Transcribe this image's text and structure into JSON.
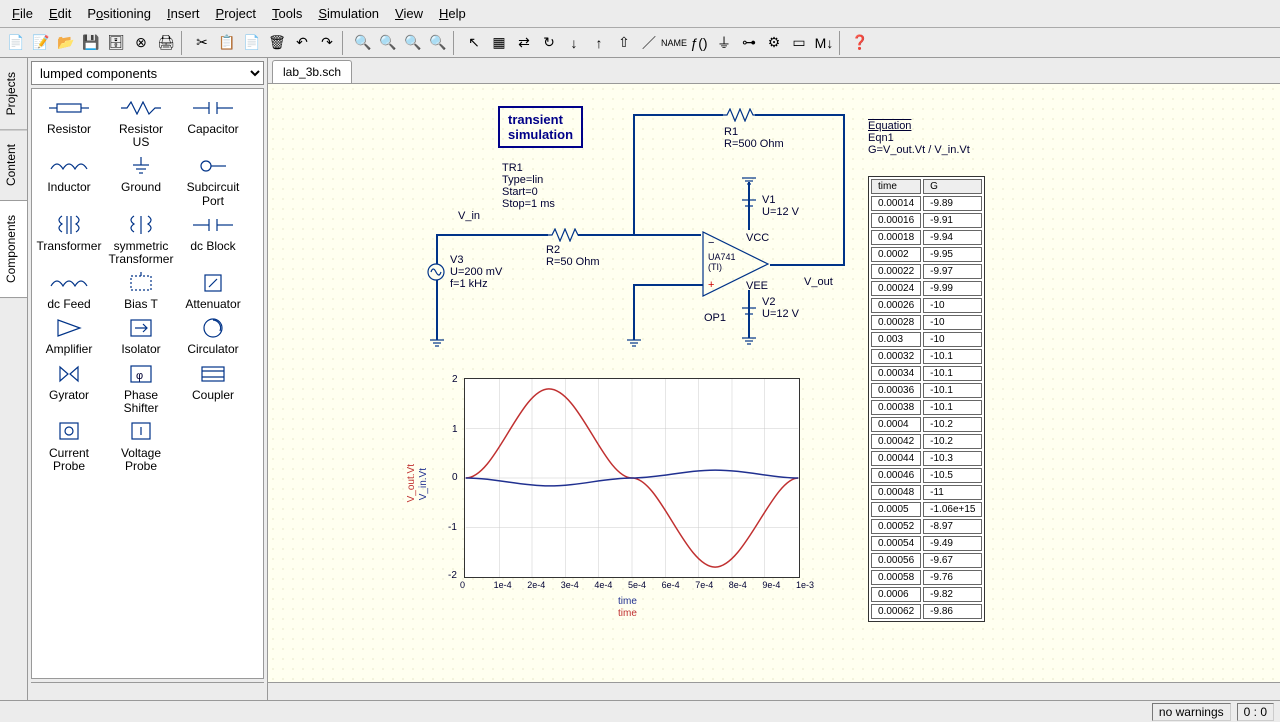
{
  "menu": [
    "File",
    "Edit",
    "Positioning",
    "Insert",
    "Project",
    "Tools",
    "Simulation",
    "View",
    "Help"
  ],
  "sideTabs": [
    "Projects",
    "Content",
    "Components"
  ],
  "combo": "lumped components",
  "components": [
    "Resistor",
    "Resistor US",
    "Capacitor",
    "Inductor",
    "Ground",
    "Subcircuit Port",
    "Transformer",
    "symmetric Transformer",
    "dc Block",
    "dc Feed",
    "Bias T",
    "Attenuator",
    "Amplifier",
    "Isolator",
    "Circulator",
    "Gyrator",
    "Phase Shifter",
    "Coupler",
    "Current Probe",
    "Voltage Probe"
  ],
  "fileTab": "lab_3b.sch",
  "schematic": {
    "simBox": {
      "l1": "transient",
      "l2": "simulation"
    },
    "simParams": [
      "TR1",
      "Type=lin",
      "Start=0",
      "Stop=1 ms"
    ],
    "vin_label": "V_in",
    "v3": [
      "V3",
      "U=200 mV",
      "f=1 kHz"
    ],
    "r1": [
      "R1",
      "R=500 Ohm"
    ],
    "r2": [
      "R2",
      "R=50 Ohm"
    ],
    "v1": [
      "V1",
      "U=12 V"
    ],
    "v2": [
      "V2",
      "U=12 V"
    ],
    "vcc": "VCC",
    "vee": "VEE",
    "ua": [
      "UA741",
      "(TI)"
    ],
    "op1": "OP1",
    "vout": "V_out",
    "eqn": {
      "title": "Equation",
      "name": "Eqn1",
      "expr": "G=V_out.Vt / V_in.Vt"
    }
  },
  "table": {
    "headers": [
      "time",
      "G"
    ],
    "rows": [
      [
        "0.00014",
        "-9.89"
      ],
      [
        "0.00016",
        "-9.91"
      ],
      [
        "0.00018",
        "-9.94"
      ],
      [
        "0.0002",
        "-9.95"
      ],
      [
        "0.00022",
        "-9.97"
      ],
      [
        "0.00024",
        "-9.99"
      ],
      [
        "0.00026",
        "-10"
      ],
      [
        "0.00028",
        "-10"
      ],
      [
        "0.003",
        "-10"
      ],
      [
        "0.00032",
        "-10.1"
      ],
      [
        "0.00034",
        "-10.1"
      ],
      [
        "0.00036",
        "-10.1"
      ],
      [
        "0.00038",
        "-10.1"
      ],
      [
        "0.0004",
        "-10.2"
      ],
      [
        "0.00042",
        "-10.2"
      ],
      [
        "0.00044",
        "-10.3"
      ],
      [
        "0.00046",
        "-10.5"
      ],
      [
        "0.00048",
        "-11"
      ],
      [
        "0.0005",
        "-1.06e+15"
      ],
      [
        "0.00052",
        "-8.97"
      ],
      [
        "0.00054",
        "-9.49"
      ],
      [
        "0.00056",
        "-9.67"
      ],
      [
        "0.00058",
        "-9.76"
      ],
      [
        "0.0006",
        "-9.82"
      ],
      [
        "0.00062",
        "-9.86"
      ]
    ]
  },
  "chart_data": {
    "type": "line",
    "xlabel": "time",
    "series": [
      {
        "name": "V_out.Vt",
        "color": "#c03030"
      },
      {
        "name": "V_in.Vt",
        "color": "#203090"
      }
    ],
    "ylim": [
      -2,
      2
    ],
    "xlim": [
      0,
      0.001
    ],
    "xticks": [
      "0",
      "1e-4",
      "2e-4",
      "3e-4",
      "4e-4",
      "5e-4",
      "6e-4",
      "7e-4",
      "8e-4",
      "9e-4",
      "1e-3"
    ],
    "yticks": [
      "-2",
      "-1",
      "0",
      "1",
      "2"
    ],
    "xunit_labels": [
      "time",
      "time"
    ]
  },
  "status": {
    "warnings": "no warnings",
    "coords": "0 : 0"
  }
}
